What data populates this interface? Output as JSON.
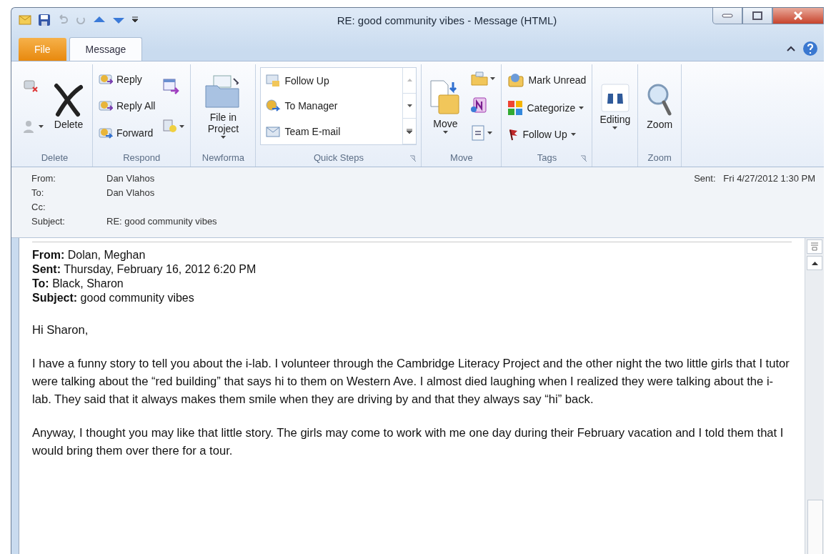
{
  "window": {
    "title": "RE: good community vibes - Message (HTML)"
  },
  "tabs": [
    {
      "label": "File",
      "kind": "file",
      "selected": false
    },
    {
      "label": "Message",
      "kind": "tab",
      "selected": true
    }
  ],
  "ribbon": {
    "groups": [
      {
        "name": "Delete",
        "columns": [
          [
            {
              "kind": "icon"
            },
            {
              "kind": "icon",
              "dropdown": true
            }
          ],
          [
            {
              "kind": "large",
              "label": "Delete"
            }
          ]
        ]
      },
      {
        "name": "Respond",
        "columns": [
          [
            {
              "kind": "small",
              "label": "Reply"
            },
            {
              "kind": "small",
              "label": "Reply All"
            },
            {
              "kind": "small",
              "label": "Forward"
            }
          ],
          [
            {
              "kind": "icon"
            },
            {
              "kind": "icon",
              "dropdown": true
            }
          ]
        ]
      },
      {
        "name": "Newforma",
        "columns": [
          [
            {
              "kind": "large",
              "label": "File in Project",
              "dropdown": true
            }
          ]
        ]
      },
      {
        "name": "Quick Steps",
        "launcher": true,
        "gallery": [
          {
            "label": "Follow Up"
          },
          {
            "label": "To Manager"
          },
          {
            "label": "Team E-mail"
          }
        ]
      },
      {
        "name": "Move",
        "columns": [
          [
            {
              "kind": "large",
              "label": "Move",
              "dropdown": true
            }
          ],
          [
            {
              "kind": "icon",
              "dropdown": true
            },
            {
              "kind": "icon"
            },
            {
              "kind": "icon",
              "dropdown": true
            }
          ]
        ]
      },
      {
        "name": "Tags",
        "launcher": true,
        "columns": [
          [
            {
              "kind": "small",
              "label": "Mark Unread"
            },
            {
              "kind": "small",
              "label": "Categorize",
              "dropdown": true
            },
            {
              "kind": "small",
              "label": "Follow Up",
              "dropdown": true
            }
          ]
        ]
      },
      {
        "columns": [
          [
            {
              "kind": "large",
              "label": "Editing",
              "dropdown": true
            }
          ]
        ]
      },
      {
        "name": "Zoom",
        "columns": [
          [
            {
              "kind": "large",
              "label": "Zoom"
            }
          ]
        ]
      }
    ]
  },
  "header": {
    "fields": [
      {
        "label": "From:",
        "value": "Dan Vlahos"
      },
      {
        "label": "To:",
        "value": "Dan Vlahos"
      },
      {
        "label": "Cc:"
      },
      {
        "label": "Subject:",
        "value": "RE: good community vibes"
      }
    ],
    "sent": {
      "label": "Sent:",
      "value": "Fri 4/27/2012 1:30 PM"
    }
  },
  "body": {
    "quoted_header": [
      {
        "label": "From:",
        "value": "Dolan, Meghan"
      },
      {
        "label": "Sent:",
        "value": "Thursday, February 16, 2012 6:20 PM"
      },
      {
        "label": "To:",
        "value": "Black, Sharon"
      },
      {
        "label": "Subject:",
        "value": "good community vibes"
      }
    ],
    "paragraphs": [
      "Hi Sharon,",
      "I have a funny story to tell you about the i-lab. I volunteer through the Cambridge Literacy Project and the other night the two little girls that I tutor were talking about the “red building” that says hi to them on Western Ave. I almost died laughing when I realized they were talking about the i-lab. They said that it always makes them smile when they are driving by and that they always say “hi” back.",
      "Anyway, I thought you may like that little story. The girls may come to work with me one day during their February vacation and I told them that I would bring them over there for a tour."
    ]
  }
}
